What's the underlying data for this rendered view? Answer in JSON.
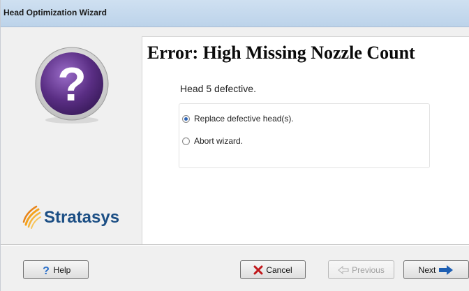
{
  "window": {
    "title": "Head Optimization Wizard"
  },
  "left_panel": {
    "logo_text": "Stratasys",
    "help_icon": "question-mark-icon",
    "logo_icon": "stratasys-logo-mark"
  },
  "content": {
    "heading": "Error: High Missing Nozzle Count",
    "message": "Head 5 defective.",
    "options": [
      {
        "label": "Replace defective head(s).",
        "selected": true
      },
      {
        "label": "Abort wizard.",
        "selected": false
      }
    ]
  },
  "buttons": {
    "help": "Help",
    "cancel": "Cancel",
    "previous": "Previous",
    "next": "Next"
  },
  "colors": {
    "help_circle": "#5a2e84",
    "logo_text": "#1b4e84",
    "next_arrow": "#1e5fb3",
    "cancel_x": "#c0171b"
  }
}
